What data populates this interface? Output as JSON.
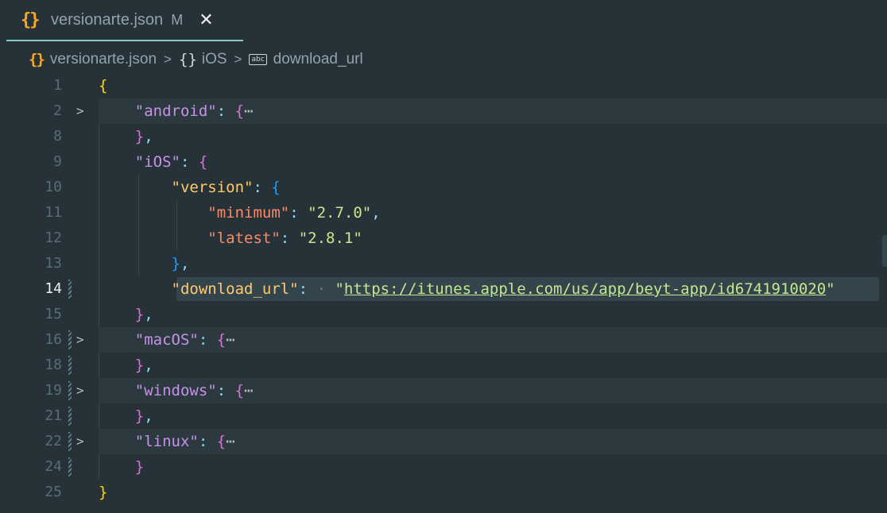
{
  "tab": {
    "title": "versionarte.json",
    "modified": "M",
    "close": "✕",
    "icon": "{}"
  },
  "breadcrumb": {
    "file": "versionarte.json",
    "obj_icon": "{}",
    "obj": "iOS",
    "abc_icon": "abc",
    "key": "download_url"
  },
  "lines": {
    "n1": "1",
    "n2": "2",
    "n8": "8",
    "n9": "9",
    "n10": "10",
    "n11": "11",
    "n12": "12",
    "n13": "13",
    "n14": "14",
    "n15": "15",
    "n16": "16",
    "n18": "18",
    "n19": "19",
    "n21": "21",
    "n22": "22",
    "n24": "24",
    "n25": "25"
  },
  "json": {
    "android": "\"android\"",
    "ios": "\"iOS\"",
    "version": "\"version\"",
    "minimum": "\"minimum\"",
    "minimum_val": "\"2.7.0\"",
    "latest": "\"latest\"",
    "latest_val": "\"2.8.1\"",
    "download_url": "\"download_url\"",
    "download_url_val": "https://itunes.apple.com/us/app/beyt-app/id6741910020",
    "macos": "\"macOS\"",
    "windows": "\"windows\"",
    "linux": "\"linux\""
  },
  "colors": {
    "background": "#263238",
    "tab_accent": "#80cbc4",
    "json_icon": "#f9a825"
  }
}
